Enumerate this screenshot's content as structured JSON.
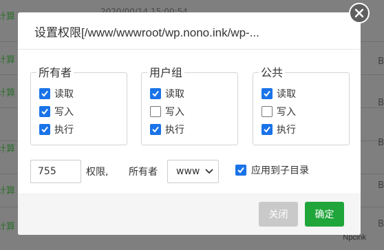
{
  "background": {
    "top_text": "2020/00/14 15:00:54",
    "left_items": [
      "计算",
      "计算",
      "计算",
      "计算",
      "计算",
      "计算"
    ],
    "right_items": [
      "B",
      "B",
      "B",
      "B",
      "B",
      "B"
    ],
    "watermark": "Npcink"
  },
  "dialog": {
    "title": "设置权限[/www/wwwroot/wp.nono.ink/wp-...",
    "groups": [
      {
        "legend": "所有者",
        "perms": [
          {
            "label": "读取",
            "checked": true
          },
          {
            "label": "写入",
            "checked": true
          },
          {
            "label": "执行",
            "checked": true
          }
        ]
      },
      {
        "legend": "用户组",
        "perms": [
          {
            "label": "读取",
            "checked": true
          },
          {
            "label": "写入",
            "checked": false
          },
          {
            "label": "执行",
            "checked": true
          }
        ]
      },
      {
        "legend": "公共",
        "perms": [
          {
            "label": "读取",
            "checked": true
          },
          {
            "label": "写入",
            "checked": false
          },
          {
            "label": "执行",
            "checked": true
          }
        ]
      }
    ],
    "mode_value": "755",
    "perm_label": "权限,",
    "owner_label": "所有者",
    "owner_value": "www",
    "apply_subdir": {
      "label": "应用到子目录",
      "checked": true
    },
    "buttons": {
      "close": "关闭",
      "ok": "确定"
    }
  },
  "colors": {
    "accent": "#1a73e8",
    "confirm": "#20a53a",
    "disabled": "#c9c9c9"
  }
}
